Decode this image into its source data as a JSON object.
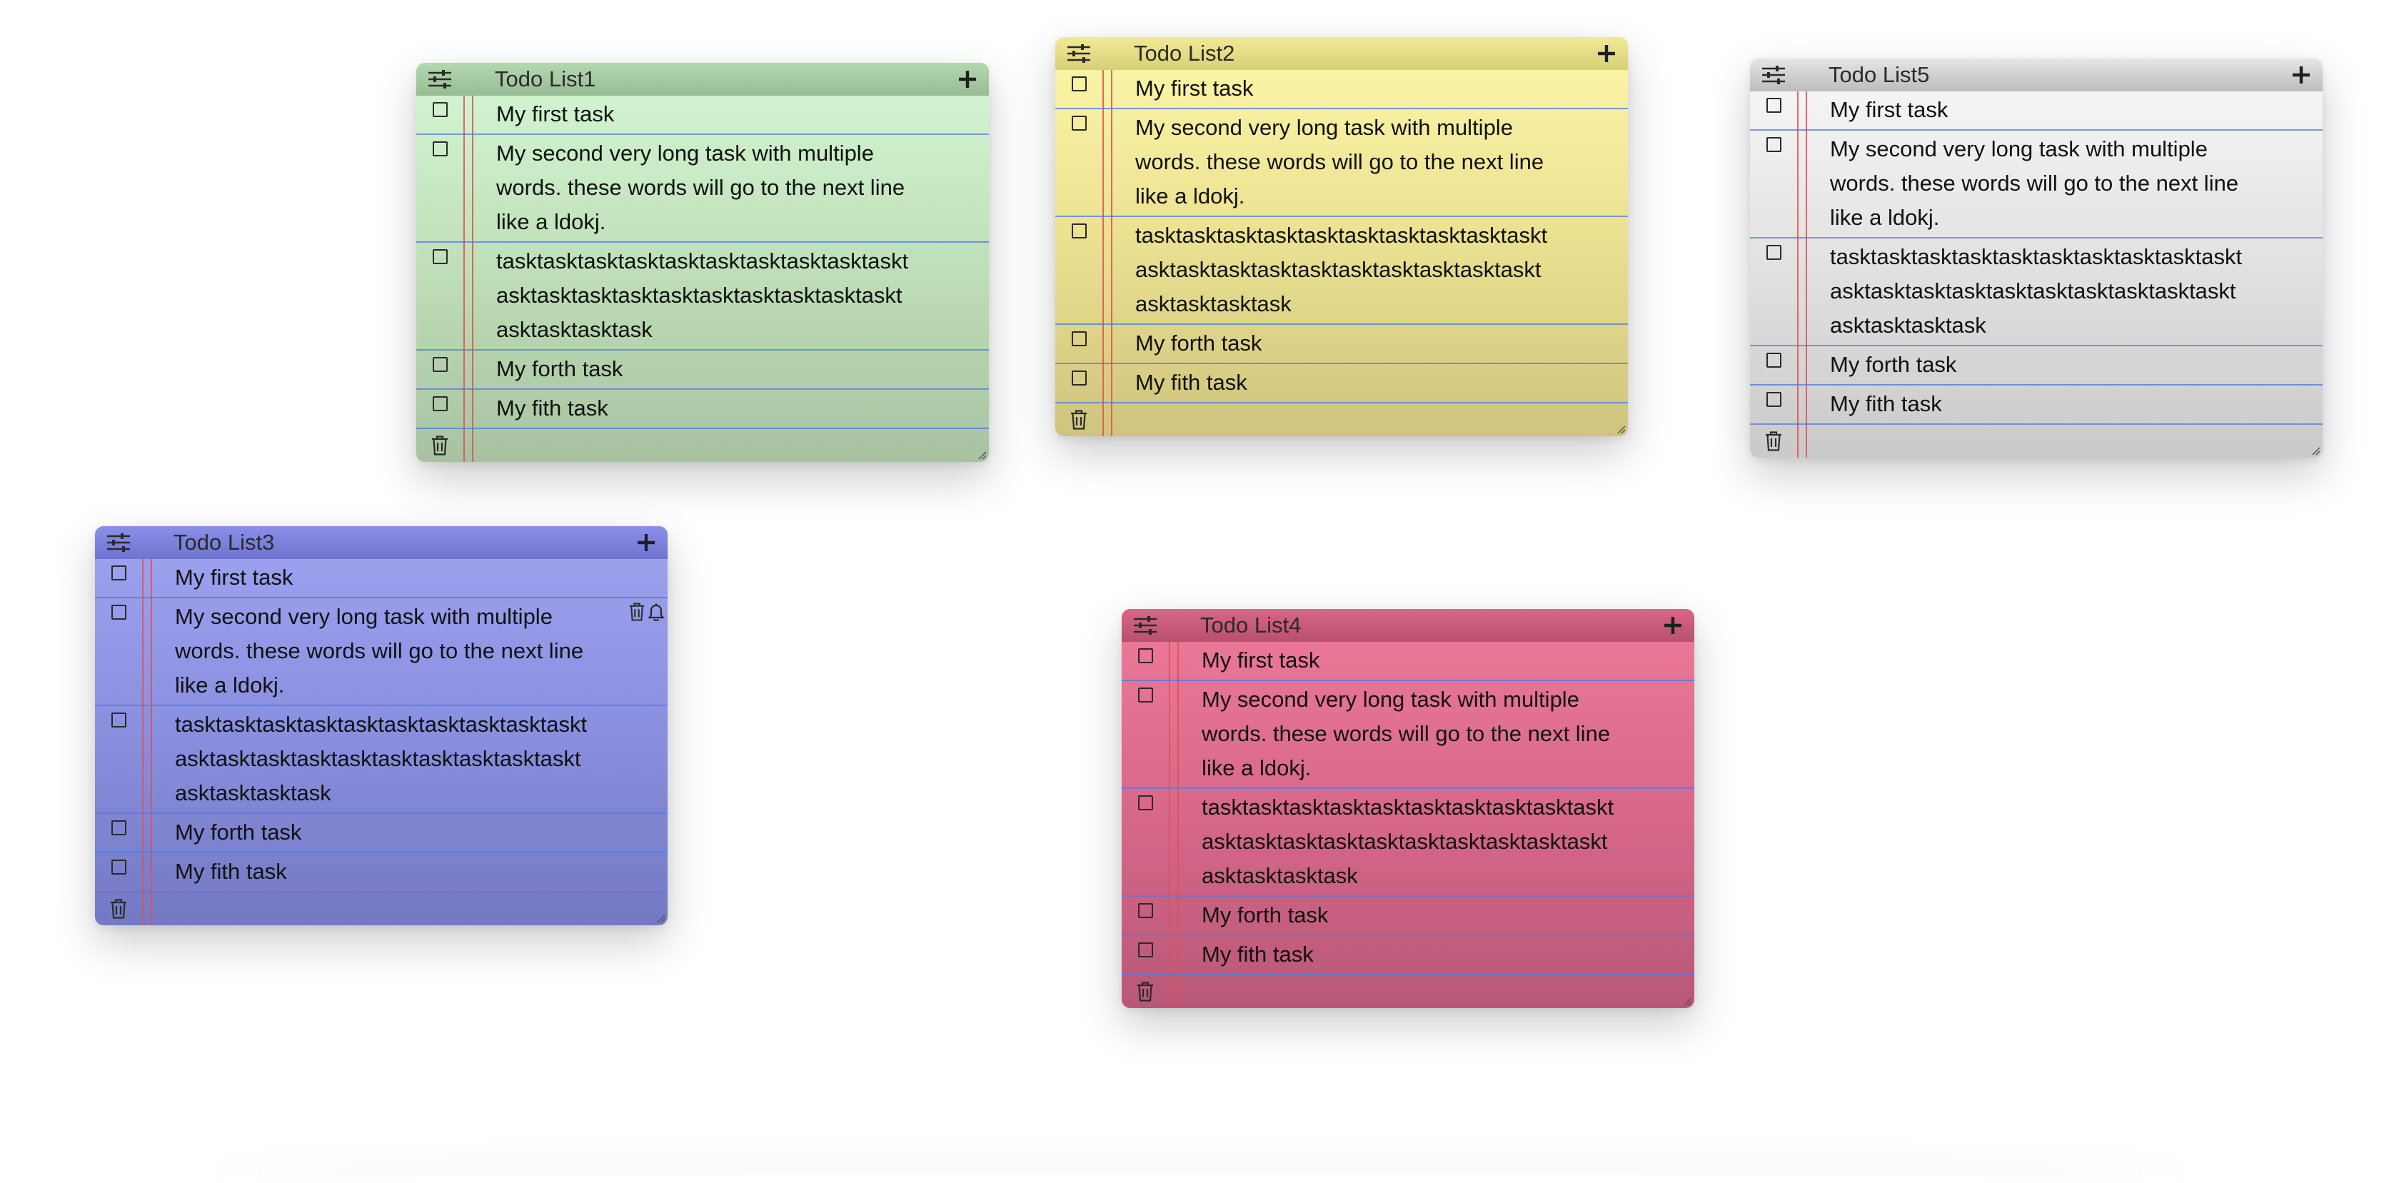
{
  "colors": {
    "green": "#c6e8c2",
    "yellow": "#f0e89a",
    "gray": "#e0e0e0",
    "blue": "#8a90e0",
    "pink": "#d8688a",
    "margin_line": "#e05050",
    "rule_line": "#5078e6"
  },
  "icons": {
    "settings": "sliders-icon",
    "add": "plus-icon",
    "delete": "trash-icon",
    "reminder": "bell-icon",
    "resize": "resize-grip-icon"
  },
  "lists": [
    {
      "title": "Todo List1",
      "tasks": [
        "My first task",
        "My second very long task with multiple words. these words will go to the next line like a ldokj.",
        "tasktasktasktasktasktasktasktasktasktasktasktasktasktasktasktasktasktasktasktasktasktasktasktask",
        "My forth task",
        "My fith task"
      ]
    },
    {
      "title": "Todo List2",
      "tasks": [
        "My first task",
        "My second very long task with multiple words. these words will go to the next line like a ldokj.",
        "tasktasktasktasktasktasktasktasktasktasktasktasktasktasktasktasktasktasktasktasktasktasktasktask",
        "My forth task",
        "My fith task"
      ]
    },
    {
      "title": "Todo List5",
      "tasks": [
        "My first task",
        "My second very long task with multiple words. these words will go to the next line like a ldokj.",
        "tasktasktasktasktasktasktasktasktasktasktasktasktasktasktasktasktasktasktasktasktasktasktasktask",
        "My forth task",
        "My fith task"
      ]
    },
    {
      "title": "Todo List3",
      "tasks": [
        "My first task",
        "My second very long task with multiple words. these words will go to the next line like a ldokj.",
        "tasktasktasktasktasktasktasktasktasktasktasktasktasktasktasktasktasktasktasktasktasktasktasktask",
        "My forth task",
        "My fith task"
      ]
    },
    {
      "title": "Todo List4",
      "tasks": [
        "My first task",
        "My second very long task with multiple words. these words will go to the next line like a ldokj.",
        "tasktasktasktasktasktasktasktasktasktasktasktasktasktasktasktasktasktasktasktasktasktasktasktask",
        "My forth task",
        "My fith task"
      ]
    }
  ]
}
